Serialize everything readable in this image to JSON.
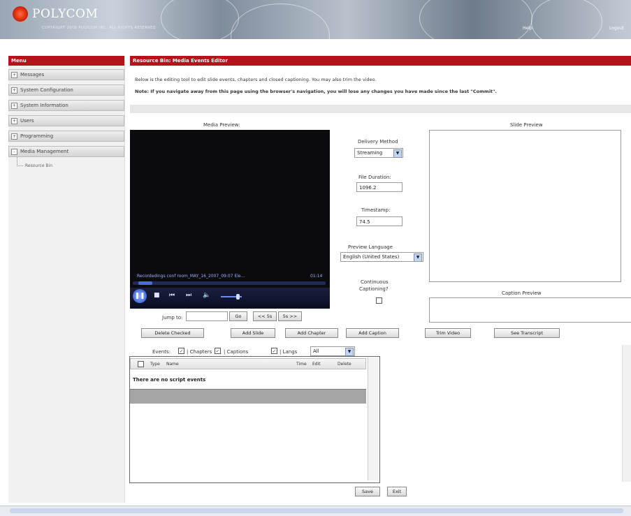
{
  "banner": {
    "brand": "POLYCOM",
    "copyright": "COPYRIGHT 2008 POLYCOM INC. ALL RIGHTS RESERVED",
    "right_link1": "Help",
    "right_link2": "Logout"
  },
  "menu": {
    "title": "Menu",
    "items": [
      {
        "label": "Messages",
        "toggle": "+"
      },
      {
        "label": "System Configuration",
        "toggle": "+"
      },
      {
        "label": "System Information",
        "toggle": "+"
      },
      {
        "label": "Users",
        "toggle": "+"
      },
      {
        "label": "Programming",
        "toggle": "+"
      },
      {
        "label": "Media Management",
        "toggle": "-"
      }
    ],
    "subitem": "Resource Bin"
  },
  "main": {
    "title": "Resource Bin: Media Events Editor",
    "desc1": "Below is the editing tool to edit slide events, chapters and closed captioning. You may also trim the video.",
    "desc2": "Note: If you navigate away from this page using the browser's navigation, you will lose any changes you have made since the last \"Commit\"."
  },
  "media": {
    "label": "Media Preview:",
    "caption": "Recordedings conf room_MAY_16_2007_09:07 Ele...",
    "time": "01:14",
    "icons": [
      "play-icon",
      "stop-icon",
      "prev-icon",
      "next-icon",
      "volume-icon"
    ]
  },
  "controls": {
    "delivery_label": "Delivery Method",
    "delivery_value": "Streaming",
    "duration_label": "File Duration:",
    "duration_value": "1096.2",
    "timestamp_label": "Timestamp:",
    "timestamp_value": "74.5",
    "preview_lang_label": "Preview Language",
    "preview_lang_value": "English (United States)",
    "continuous_label1": "Continuous",
    "continuous_label2": "Captioning?"
  },
  "slide_preview_label": "Slide Preview",
  "caption_preview_label": "Caption Preview",
  "jump": {
    "label": "Jump to:",
    "go": "Go",
    "back": "<< 5s",
    "fwd": "5s >>"
  },
  "buttons": {
    "delete_checked": "Delete Checked",
    "add_slide": "Add Slide",
    "add_chapter": "Add Chapter",
    "add_caption": "Add Caption",
    "trim_video": "Trim Video",
    "see_transcript": "See Transcript",
    "save": "Save",
    "exit": "Exit"
  },
  "filters": {
    "events": "Events:",
    "chapters": "| Chapters",
    "captions": "| Captions",
    "langs": "| Langs",
    "langs_value": "All"
  },
  "events_table": {
    "columns": [
      "Type",
      "Name",
      "Time",
      "Edit",
      "Delete"
    ],
    "empty": "There are no script events"
  },
  "colors": {
    "header_red": "#b5121b",
    "video_bg": "#0b0b0d"
  }
}
